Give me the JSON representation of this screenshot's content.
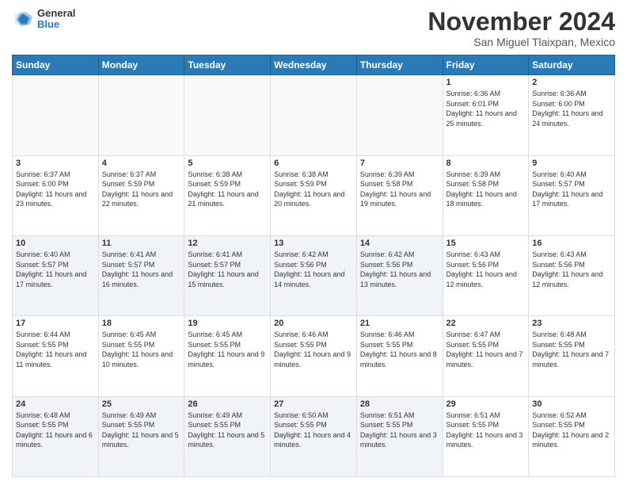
{
  "logo": {
    "general": "General",
    "blue": "Blue"
  },
  "header": {
    "month": "November 2024",
    "location": "San Miguel Tlaixpan, Mexico"
  },
  "weekdays": [
    "Sunday",
    "Monday",
    "Tuesday",
    "Wednesday",
    "Thursday",
    "Friday",
    "Saturday"
  ],
  "weeks": [
    [
      {
        "day": "",
        "info": ""
      },
      {
        "day": "",
        "info": ""
      },
      {
        "day": "",
        "info": ""
      },
      {
        "day": "",
        "info": ""
      },
      {
        "day": "",
        "info": ""
      },
      {
        "day": "1",
        "info": "Sunrise: 6:36 AM\nSunset: 6:01 PM\nDaylight: 11 hours and 25 minutes."
      },
      {
        "day": "2",
        "info": "Sunrise: 6:36 AM\nSunset: 6:00 PM\nDaylight: 11 hours and 24 minutes."
      }
    ],
    [
      {
        "day": "3",
        "info": "Sunrise: 6:37 AM\nSunset: 6:00 PM\nDaylight: 11 hours and 23 minutes."
      },
      {
        "day": "4",
        "info": "Sunrise: 6:37 AM\nSunset: 5:59 PM\nDaylight: 11 hours and 22 minutes."
      },
      {
        "day": "5",
        "info": "Sunrise: 6:38 AM\nSunset: 5:59 PM\nDaylight: 11 hours and 21 minutes."
      },
      {
        "day": "6",
        "info": "Sunrise: 6:38 AM\nSunset: 5:59 PM\nDaylight: 11 hours and 20 minutes."
      },
      {
        "day": "7",
        "info": "Sunrise: 6:39 AM\nSunset: 5:58 PM\nDaylight: 11 hours and 19 minutes."
      },
      {
        "day": "8",
        "info": "Sunrise: 6:39 AM\nSunset: 5:58 PM\nDaylight: 11 hours and 18 minutes."
      },
      {
        "day": "9",
        "info": "Sunrise: 6:40 AM\nSunset: 5:57 PM\nDaylight: 11 hours and 17 minutes."
      }
    ],
    [
      {
        "day": "10",
        "info": "Sunrise: 6:40 AM\nSunset: 5:57 PM\nDaylight: 11 hours and 17 minutes."
      },
      {
        "day": "11",
        "info": "Sunrise: 6:41 AM\nSunset: 5:57 PM\nDaylight: 11 hours and 16 minutes."
      },
      {
        "day": "12",
        "info": "Sunrise: 6:41 AM\nSunset: 5:57 PM\nDaylight: 11 hours and 15 minutes."
      },
      {
        "day": "13",
        "info": "Sunrise: 6:42 AM\nSunset: 5:56 PM\nDaylight: 11 hours and 14 minutes."
      },
      {
        "day": "14",
        "info": "Sunrise: 6:42 AM\nSunset: 5:56 PM\nDaylight: 11 hours and 13 minutes."
      },
      {
        "day": "15",
        "info": "Sunrise: 6:43 AM\nSunset: 5:56 PM\nDaylight: 11 hours and 12 minutes."
      },
      {
        "day": "16",
        "info": "Sunrise: 6:43 AM\nSunset: 5:56 PM\nDaylight: 11 hours and 12 minutes."
      }
    ],
    [
      {
        "day": "17",
        "info": "Sunrise: 6:44 AM\nSunset: 5:55 PM\nDaylight: 11 hours and 11 minutes."
      },
      {
        "day": "18",
        "info": "Sunrise: 6:45 AM\nSunset: 5:55 PM\nDaylight: 11 hours and 10 minutes."
      },
      {
        "day": "19",
        "info": "Sunrise: 6:45 AM\nSunset: 5:55 PM\nDaylight: 11 hours and 9 minutes."
      },
      {
        "day": "20",
        "info": "Sunrise: 6:46 AM\nSunset: 5:55 PM\nDaylight: 11 hours and 9 minutes."
      },
      {
        "day": "21",
        "info": "Sunrise: 6:46 AM\nSunset: 5:55 PM\nDaylight: 11 hours and 8 minutes."
      },
      {
        "day": "22",
        "info": "Sunrise: 6:47 AM\nSunset: 5:55 PM\nDaylight: 11 hours and 7 minutes."
      },
      {
        "day": "23",
        "info": "Sunrise: 6:48 AM\nSunset: 5:55 PM\nDaylight: 11 hours and 7 minutes."
      }
    ],
    [
      {
        "day": "24",
        "info": "Sunrise: 6:48 AM\nSunset: 5:55 PM\nDaylight: 11 hours and 6 minutes."
      },
      {
        "day": "25",
        "info": "Sunrise: 6:49 AM\nSunset: 5:55 PM\nDaylight: 11 hours and 5 minutes."
      },
      {
        "day": "26",
        "info": "Sunrise: 6:49 AM\nSunset: 5:55 PM\nDaylight: 11 hours and 5 minutes."
      },
      {
        "day": "27",
        "info": "Sunrise: 6:50 AM\nSunset: 5:55 PM\nDaylight: 11 hours and 4 minutes."
      },
      {
        "day": "28",
        "info": "Sunrise: 6:51 AM\nSunset: 5:55 PM\nDaylight: 11 hours and 3 minutes."
      },
      {
        "day": "29",
        "info": "Sunrise: 6:51 AM\nSunset: 5:55 PM\nDaylight: 11 hours and 3 minutes."
      },
      {
        "day": "30",
        "info": "Sunrise: 6:52 AM\nSunset: 5:55 PM\nDaylight: 11 hours and 2 minutes."
      }
    ]
  ]
}
